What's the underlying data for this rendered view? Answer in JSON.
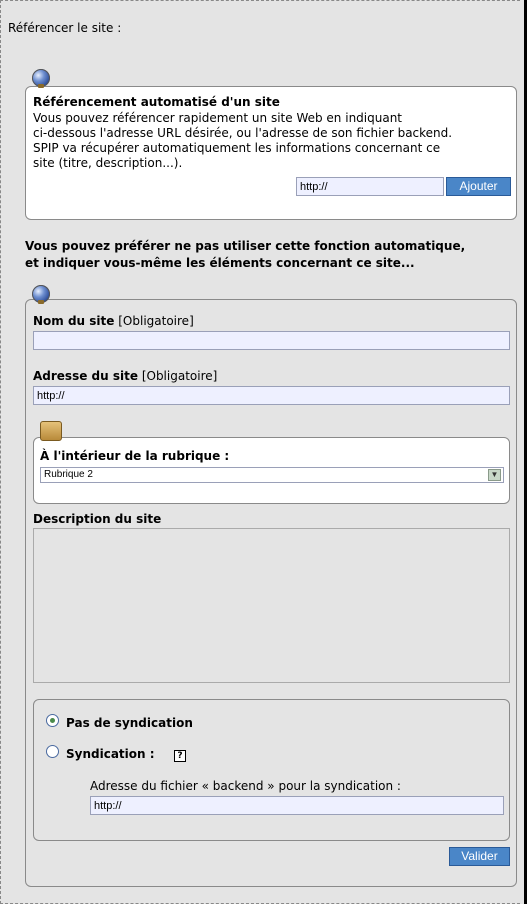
{
  "page": {
    "heading": "Référencer le site :"
  },
  "auto": {
    "title": "Référencement automatisé d'un site",
    "desc_line1": "Vous pouvez référencer rapidement un site Web en indiquant",
    "desc_line2": "ci-dessous l'adresse URL désirée, ou l'adresse de son fichier backend.",
    "desc_line3": "SPIP va récupérer automatiquement les informations concernant ce",
    "desc_line4": "site (titre, description...).",
    "url_value": "http://",
    "add_button": "Ajouter"
  },
  "manual": {
    "intro_line1": "Vous pouvez préférer ne pas utiliser cette fonction automatique,",
    "intro_line2": "et indiquer vous-même les éléments concernant ce site...",
    "name_label": "Nom du site",
    "name_required": "[Obligatoire]",
    "name_value": "",
    "url_label": "Adresse du site",
    "url_required": "[Obligatoire]",
    "url_value": "http://",
    "rubrique_label": "À l'intérieur de la rubrique :",
    "rubrique_selected": "Rubrique 2",
    "description_label": "Description du site",
    "description_value": ""
  },
  "syndication": {
    "option_none": "Pas de syndication",
    "option_syndication": "Syndication :",
    "help_glyph": "?",
    "selected": "none",
    "backend_label": "Adresse du fichier « backend » pour la syndication :",
    "backend_value": "http://"
  },
  "actions": {
    "submit": "Valider"
  },
  "icons": {
    "globe": "globe-icon",
    "rubrique": "box-icon"
  }
}
